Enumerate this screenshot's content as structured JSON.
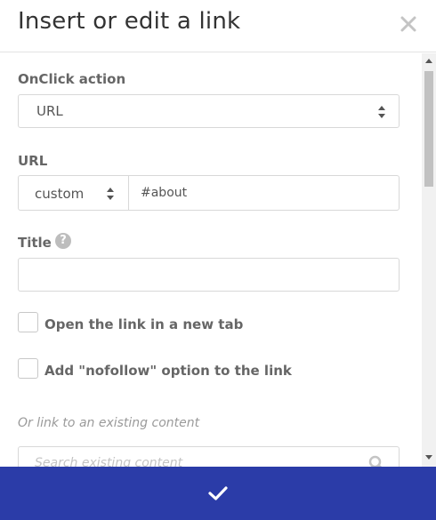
{
  "dialog": {
    "title": "Insert or edit a link",
    "close_icon": "close-icon",
    "accent_color": "#2b3ca8"
  },
  "onclick": {
    "label": "OnClick action",
    "selected": "URL"
  },
  "url": {
    "label": "URL",
    "type_selected": "custom",
    "value": "#about"
  },
  "title_field": {
    "label": "Title",
    "help_glyph": "?",
    "value": ""
  },
  "options": {
    "new_tab": {
      "label": "Open the link in a new tab",
      "checked": false
    },
    "nofollow": {
      "label": "Add \"nofollow\" option to the link",
      "checked": false
    }
  },
  "existing": {
    "hint": "Or link to an existing content",
    "search_placeholder": "Search existing content"
  },
  "footer": {
    "confirm_icon": "check-icon"
  }
}
